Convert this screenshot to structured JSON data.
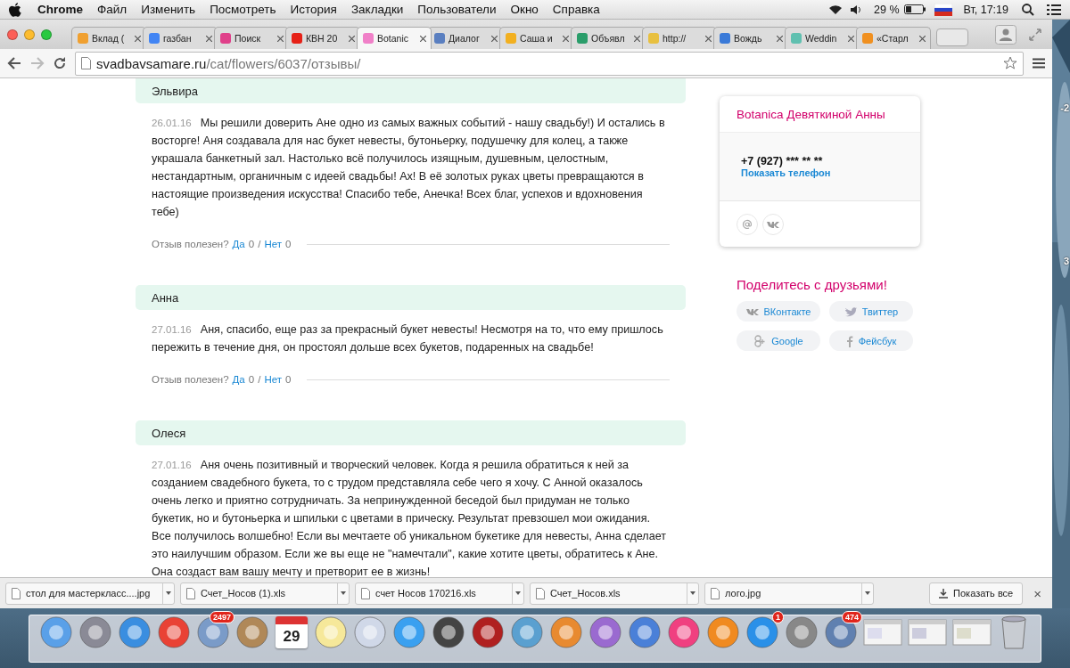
{
  "menu_bar": {
    "app": "Chrome",
    "items": [
      "Файл",
      "Изменить",
      "Посмотреть",
      "История",
      "Закладки",
      "Пользователи",
      "Окно",
      "Справка"
    ],
    "battery": "29 %",
    "clock": "Вт, 17:19"
  },
  "tabs": [
    {
      "title": "Вклад (",
      "selected": false
    },
    {
      "title": "газбан",
      "selected": false
    },
    {
      "title": "Поиск",
      "selected": false
    },
    {
      "title": "КВН 20",
      "selected": false
    },
    {
      "title": "Botanic",
      "selected": true
    },
    {
      "title": "Диалог",
      "selected": false
    },
    {
      "title": "Саша и",
      "selected": false
    },
    {
      "title": "Объявл",
      "selected": false
    },
    {
      "title": "http://",
      "selected": false
    },
    {
      "title": "Вождь",
      "selected": false
    },
    {
      "title": "Weddin",
      "selected": false
    },
    {
      "title": "«Старл",
      "selected": false
    }
  ],
  "address_bar": {
    "host": "svadbavsamare.ru",
    "path": "/cat/flowers/6037/отзывы/"
  },
  "reviews": [
    {
      "author": "Эльвира",
      "date": "26.01.16",
      "text": "Мы решили доверить Ане одно из самых важных событий - нашу свадьбу!) И остались в восторге! Аня создавала для нас букет невесты, бутоньерку, подушечку для колец, а также украшала банкетный зал. Настолько всё получилось изящным, душевным, целостным, нестандартным, органичным с идеей свадьбы! Ах! В её золотых руках цветы превращаются в настоящие произведения искусства! Спасибо тебе, Анечка! Всех благ, успехов и вдохновения тебе)",
      "footer": {
        "label": "Отзыв полезен?",
        "yes": "Да",
        "yes_count": "0",
        "separator": "/",
        "no": "Нет",
        "no_count": "0"
      }
    },
    {
      "author": "Анна",
      "date": "27.01.16",
      "text": "Аня, спасибо, еще раз за прекрасный букет невесты! Несмотря на то, что ему пришлось пережить в течение дня, он простоял дольше всех букетов, подаренных на свадьбе!",
      "footer": {
        "label": "Отзыв полезен?",
        "yes": "Да",
        "yes_count": "0",
        "separator": "/",
        "no": "Нет",
        "no_count": "0"
      }
    },
    {
      "author": "Олеся",
      "date": "27.01.16",
      "text": "Аня очень позитивный и творческий человек. Когда я решила обратиться к ней за созданием свадебного букета, то с трудом представляла себе чего я хочу. С Анной оказалось очень легко и приятно сотрудничать. За непринужденной беседой был придуман не только букетик, но и бутоньерка и шпильки с цветами в прическу. Результат превзошел мои ожидания. Все получилось волшебно! Если вы мечтаете об уникальном букетике для невесты, Анна сделает это наилучшим образом. Если же вы еще не \"намечтали\", какие хотите цветы, обратитесь к Ане. Она создаст вам вашу мечту и претворит ее в жизнь!"
    }
  ],
  "contact_card": {
    "title": "Botanica Девяткиной Анны",
    "phone": "+7 (927) *** ** **",
    "show_phone": "Показать телефон"
  },
  "share": {
    "title": "Поделитесь с друзьями!",
    "buttons": [
      {
        "kind": "vk",
        "label": "ВКонтакте"
      },
      {
        "kind": "twitter",
        "label": "Твиттер"
      },
      {
        "kind": "google",
        "label": "Google"
      },
      {
        "kind": "facebook",
        "label": "Фейсбук"
      }
    ]
  },
  "downloads": {
    "items": [
      "стол для мастеркласс....jpg",
      "Счет_Носов (1).xls",
      "счет Носов 170216.xls",
      "Счет_Носов.xls",
      "лого.jpg"
    ],
    "show_all": "Показать все",
    "close": "×"
  },
  "desktop_labels": [
    "-2",
    "3"
  ],
  "dock": [
    {
      "kind": "app"
    },
    {
      "kind": "app"
    },
    {
      "kind": "app"
    },
    {
      "kind": "app"
    },
    {
      "kind": "app",
      "badge": "2497"
    },
    {
      "kind": "app"
    },
    {
      "kind": "calendar",
      "day": "29"
    },
    {
      "kind": "app"
    },
    {
      "kind": "app"
    },
    {
      "kind": "app"
    },
    {
      "kind": "app"
    },
    {
      "kind": "app"
    },
    {
      "kind": "app"
    },
    {
      "kind": "app"
    },
    {
      "kind": "app"
    },
    {
      "kind": "app"
    },
    {
      "kind": "app"
    },
    {
      "kind": "app"
    },
    {
      "kind": "app",
      "badge": "1"
    },
    {
      "kind": "app"
    },
    {
      "kind": "app",
      "badge": "474"
    },
    {
      "kind": "window"
    },
    {
      "kind": "window"
    },
    {
      "kind": "window"
    },
    {
      "kind": "trash"
    }
  ]
}
